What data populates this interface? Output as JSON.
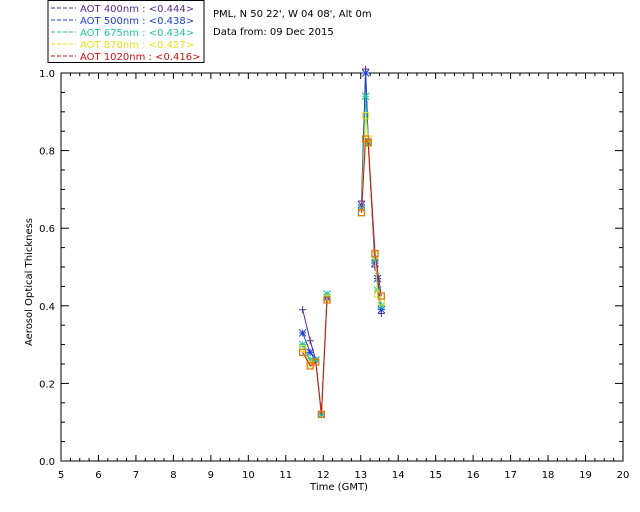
{
  "chart_data": {
    "type": "line",
    "title_lines": [
      "PML, N 50 22', W 04 08', Alt 0m",
      "Data from: 09 Dec 2015"
    ],
    "xlabel": "Time (GMT)",
    "ylabel": "Aerosol Optical Thickness",
    "xlim": [
      5,
      20
    ],
    "ylim": [
      0.0,
      1.0
    ],
    "x_ticks": [
      "5",
      "6",
      "7",
      "8",
      "9",
      "10",
      "11",
      "12",
      "13",
      "14",
      "15",
      "16",
      "17",
      "18",
      "19",
      "20"
    ],
    "y_ticks": [
      "0.0",
      "0.2",
      "0.4",
      "0.6",
      "0.8",
      "1.0"
    ],
    "grid": false,
    "legend_position": "top-left, above plot",
    "series": [
      {
        "name": "AOT  400nm : <0.444>",
        "color": "#5a2a8a",
        "marker": "plus",
        "x": [
          11.45,
          11.65,
          11.8,
          11.95,
          12.1,
          13.02,
          13.13,
          13.2,
          13.38,
          13.45,
          13.55
        ],
        "y": [
          0.39,
          0.31,
          0.26,
          0.12,
          0.42,
          0.67,
          1.01,
          0.83,
          0.5,
          0.47,
          0.38
        ]
      },
      {
        "name": "AOT  500nm : <0.438>",
        "color": "#1a3fd6",
        "marker": "star",
        "x": [
          11.45,
          11.65,
          11.8,
          11.95,
          12.1,
          13.02,
          13.13,
          13.2,
          13.38,
          13.45,
          13.55
        ],
        "y": [
          0.33,
          0.28,
          0.26,
          0.12,
          0.42,
          0.66,
          1.0,
          0.82,
          0.51,
          0.47,
          0.39
        ]
      },
      {
        "name": "AOT  675nm : <0.434>",
        "color": "#22c4a0",
        "marker": "star",
        "x": [
          11.45,
          11.65,
          11.8,
          11.95,
          12.1,
          13.02,
          13.13,
          13.2,
          13.38,
          13.45,
          13.55
        ],
        "y": [
          0.3,
          0.26,
          0.26,
          0.12,
          0.43,
          0.65,
          0.94,
          0.82,
          0.52,
          0.44,
          0.4
        ]
      },
      {
        "name": "AOT  870nm : <0.427>",
        "color": "#e8e020",
        "marker": "square",
        "x": [
          11.45,
          11.65,
          11.8,
          11.95,
          12.1,
          13.02,
          13.13,
          13.2,
          13.38,
          13.45,
          13.55
        ],
        "y": [
          0.29,
          0.25,
          0.255,
          0.12,
          0.42,
          0.64,
          0.89,
          0.83,
          0.53,
          0.43,
          0.41
        ]
      },
      {
        "name": "AOT 1020nm : <0.416>",
        "color": "#cc1111",
        "marker": "square-orange",
        "x": [
          11.45,
          11.65,
          11.8,
          11.95,
          12.1,
          13.02,
          13.13,
          13.2,
          13.38,
          13.55
        ],
        "y": [
          0.28,
          0.245,
          0.255,
          0.12,
          0.415,
          0.64,
          0.83,
          0.82,
          0.535,
          0.425
        ]
      }
    ]
  }
}
